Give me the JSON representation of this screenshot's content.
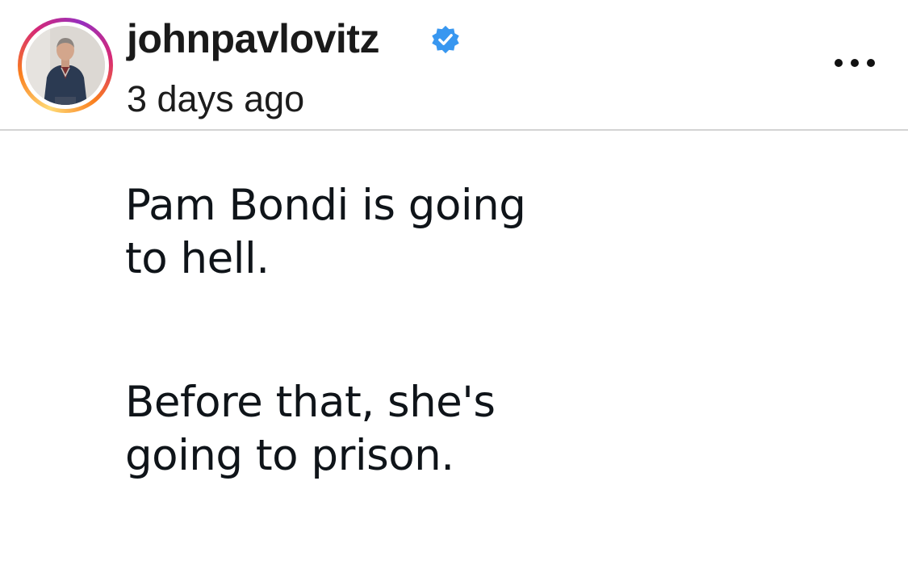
{
  "header": {
    "username": "johnpavlovitz",
    "verified": true,
    "timestamp": "3 days ago",
    "more_icon": "more-horizontal-icon"
  },
  "post": {
    "paragraph1": [
      "Pam Bondi is going",
      "to hell."
    ],
    "paragraph2": [
      "Before that, she's",
      "going to prison."
    ]
  },
  "colors": {
    "verified_badge": "#3897f0",
    "divider": "#d3d3d3",
    "story_ring_start": "#feda75",
    "story_ring_end": "#962fbf"
  }
}
